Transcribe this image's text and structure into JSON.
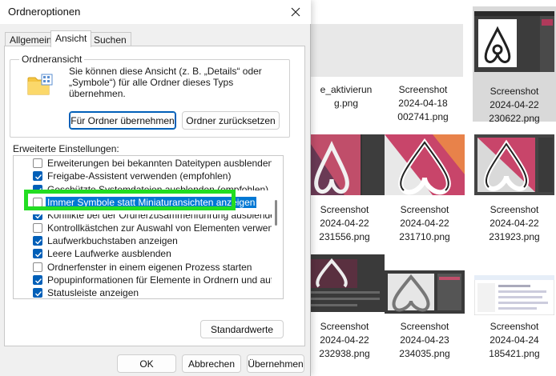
{
  "dialog": {
    "title": "Ordneroptionen",
    "tabs": [
      {
        "label": "Allgemein",
        "active": false
      },
      {
        "label": "Ansicht",
        "active": true
      },
      {
        "label": "Suchen",
        "active": false
      }
    ],
    "group_label": "Ordneransicht",
    "group_description": "Sie können diese Ansicht (z. B. „Details“ oder „Symbole“) für alle Ordner dieses Typs übernehmen.",
    "apply_button": "Für Ordner übernehmen",
    "reset_button": "Ordner zurücksetzen",
    "advanced_label": "Erweiterte Einstellungen:",
    "settings": [
      {
        "label": "Erweiterungen bei bekannten Dateitypen ausblenden",
        "checked": false
      },
      {
        "label": "Freigabe-Assistent verwenden (empfohlen)",
        "checked": true
      },
      {
        "label": "Geschützte Systemdateien ausblenden (empfohlen)",
        "checked": true
      },
      {
        "label": "Immer Symbole statt Miniaturansichten anzeigen",
        "checked": false,
        "selected": true
      },
      {
        "label": "Konflikte bei der Ordnerzusammenführung ausblenden",
        "checked": true
      },
      {
        "label": "Kontrollkästchen zur Auswahl von Elementen verwenden",
        "checked": false
      },
      {
        "label": "Laufwerkbuchstaben anzeigen",
        "checked": true
      },
      {
        "label": "Leere Laufwerke ausblenden",
        "checked": true
      },
      {
        "label": "Ordnerfenster in einem eigenen Prozess starten",
        "checked": false
      },
      {
        "label": "Popupinformationen für Elemente in Ordnern und auf dem D",
        "checked": true
      },
      {
        "label": "Statusleiste anzeigen",
        "checked": true
      }
    ],
    "defaults_button": "Standardwerte",
    "ok_button": "OK",
    "cancel_button": "Abbrechen",
    "apply_bottom_button": "Übernehmen",
    "highlight_color": "#22dd22",
    "accent_color": "#005fb8"
  },
  "explorer": {
    "files": [
      {
        "lines": [
          "e_aktivierun",
          "g.png"
        ]
      },
      {
        "lines": [
          "Screenshot",
          "2024-04-18",
          "002741.png"
        ]
      },
      {
        "lines": [
          "Screenshot",
          "2024-04-22",
          "230622.png"
        ],
        "selected": true
      },
      {
        "lines": [
          "Screenshot",
          "2024-04-22",
          "231556.png"
        ]
      },
      {
        "lines": [
          "Screenshot",
          "2024-04-22",
          "231710.png"
        ]
      },
      {
        "lines": [
          "Screenshot",
          "2024-04-22",
          "231923.png"
        ]
      },
      {
        "lines": [
          "Screenshot",
          "2024-04-22",
          "232938.png"
        ]
      },
      {
        "lines": [
          "Screenshot",
          "2024-04-23",
          "234035.png"
        ]
      },
      {
        "lines": [
          "Screenshot",
          "2024-04-24",
          "185421.png"
        ]
      }
    ]
  }
}
